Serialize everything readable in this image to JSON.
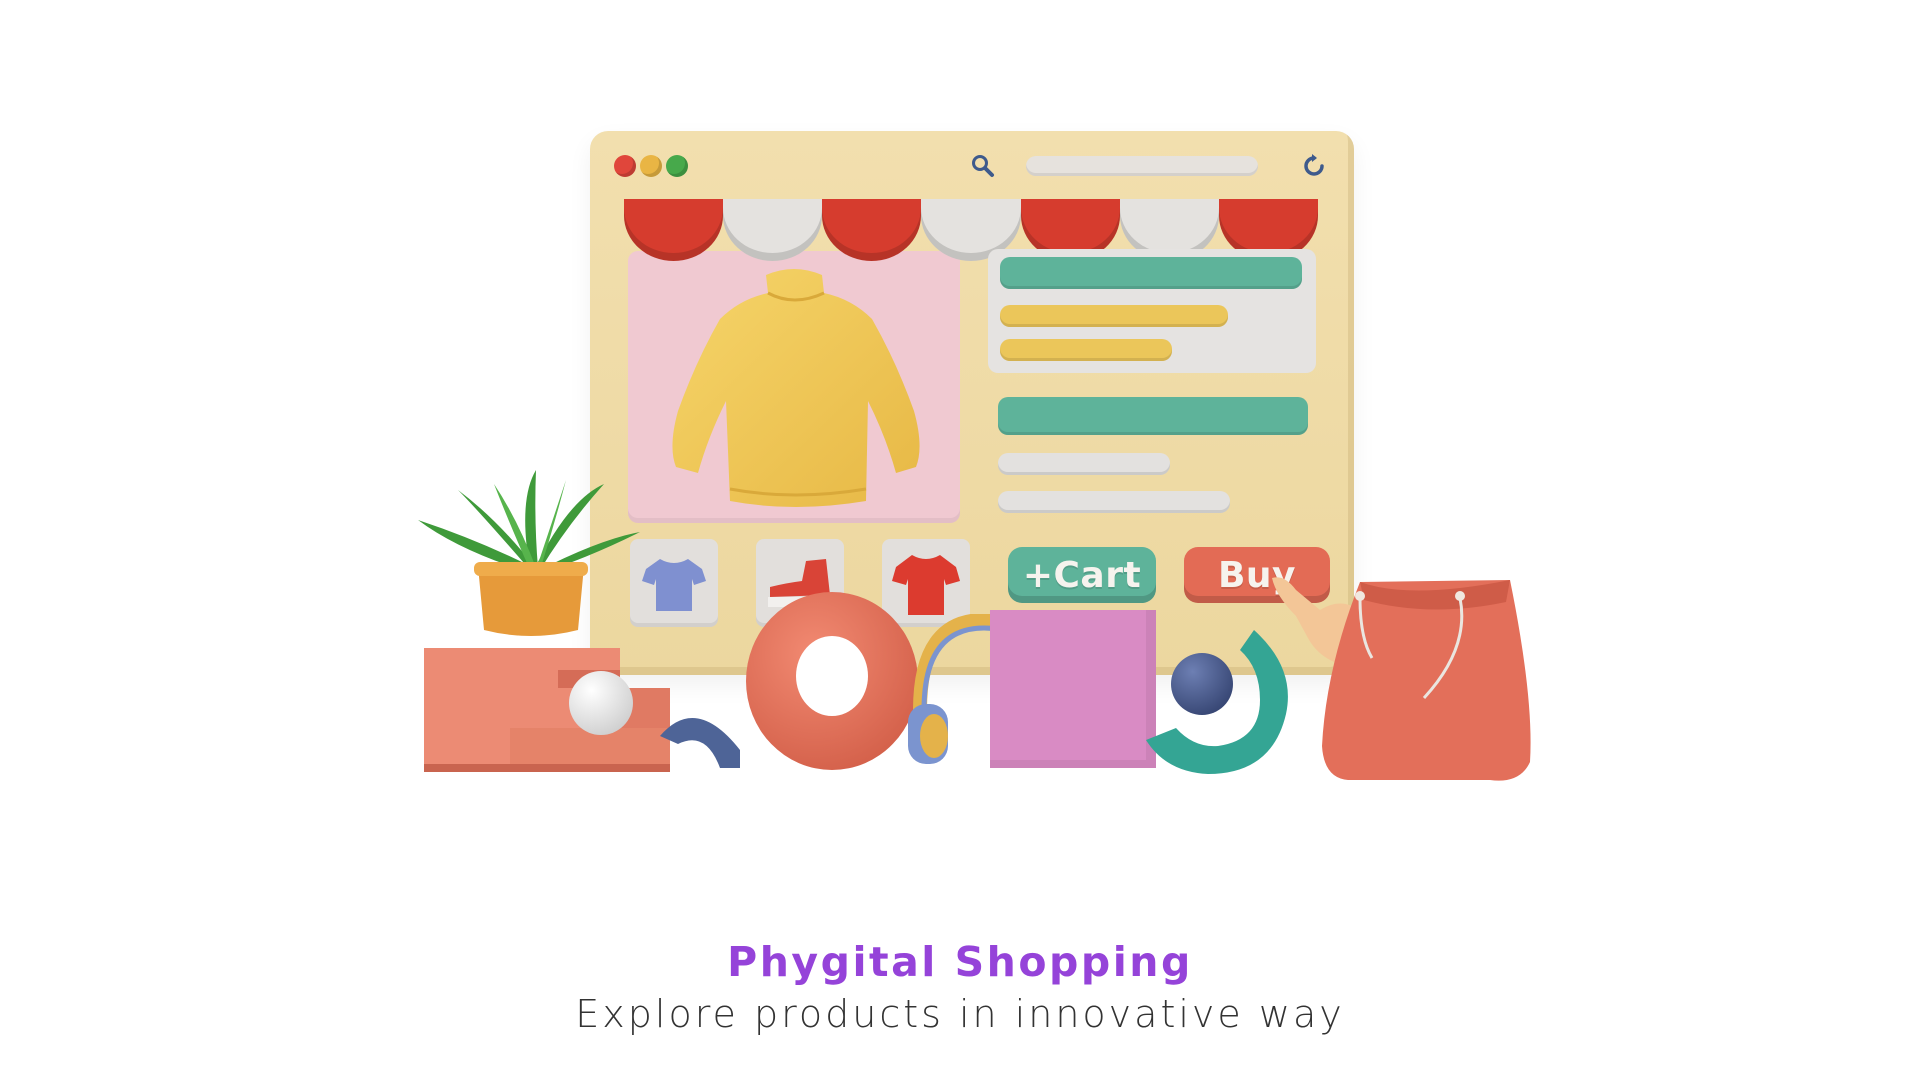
{
  "window": {
    "traffic_lights": [
      "red",
      "yellow",
      "green"
    ],
    "search_icon": "search-icon",
    "refresh_icon": "refresh-icon"
  },
  "product": {
    "main_image": "yellow-sweater",
    "thumbnails": [
      "blue-tshirt",
      "red-sneaker",
      "red-tshirt"
    ]
  },
  "buttons": {
    "cart_label": "+Cart",
    "buy_label": "Buy"
  },
  "colors": {
    "window": "#ecd79f",
    "awning_red": "#d63c2e",
    "awning_white": "#e4e2df",
    "accent_green": "#5eb39a",
    "accent_coral": "#e36b55",
    "title_purple": "#9543d9"
  },
  "caption": {
    "title": "Phygital Shopping",
    "subtitle": "Explore products in innovative way"
  }
}
